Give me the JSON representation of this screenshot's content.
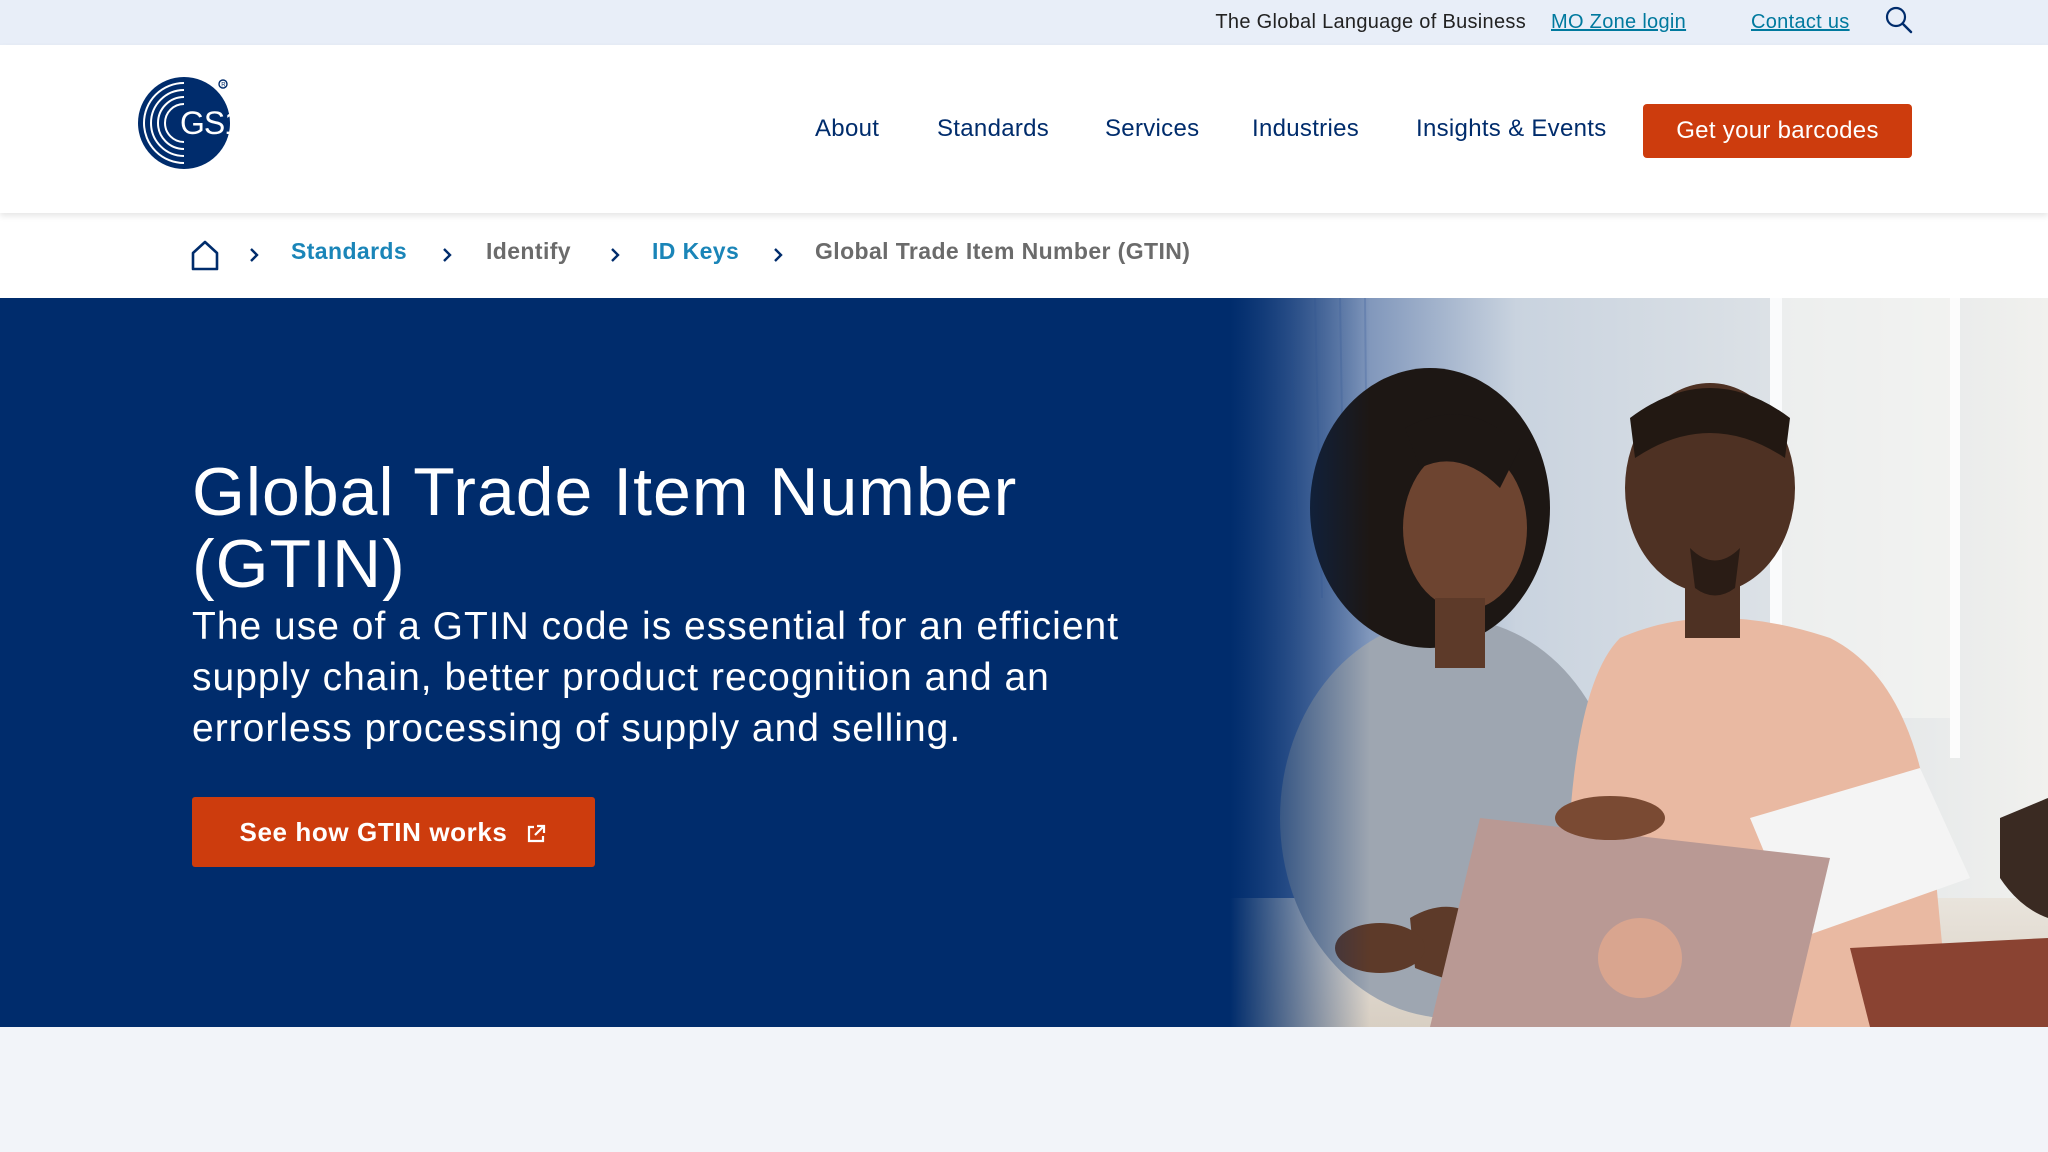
{
  "utility_bar": {
    "tagline": "The Global Language of Business",
    "mo_zone_login": "MO Zone login",
    "contact_us": "Contact us",
    "search_icon": "search-icon"
  },
  "header": {
    "logo_text": "GS1",
    "nav": [
      "About",
      "Standards",
      "Services",
      "Industries",
      "Insights & Events"
    ],
    "cta_label": "Get your barcodes"
  },
  "breadcrumb": {
    "home_icon": "home-icon",
    "items": [
      "Standards",
      "Identify",
      "ID Keys",
      "Global Trade Item Number (GTIN)"
    ]
  },
  "hero": {
    "title": "Global Trade Item Number (GTIN)",
    "subtitle": "The use of a GTIN code is essential for an efficient supply chain, better product recognition and an errorless processing of supply and selling.",
    "cta_label": "See how GTIN works",
    "cta_icon": "external-link-icon"
  },
  "colors": {
    "brand_navy": "#002c6c",
    "brand_orange": "#cd3c0d",
    "link_blue": "#1a85b8",
    "utility_bg": "#e8eef8",
    "page_bg": "#f2f4f9"
  }
}
